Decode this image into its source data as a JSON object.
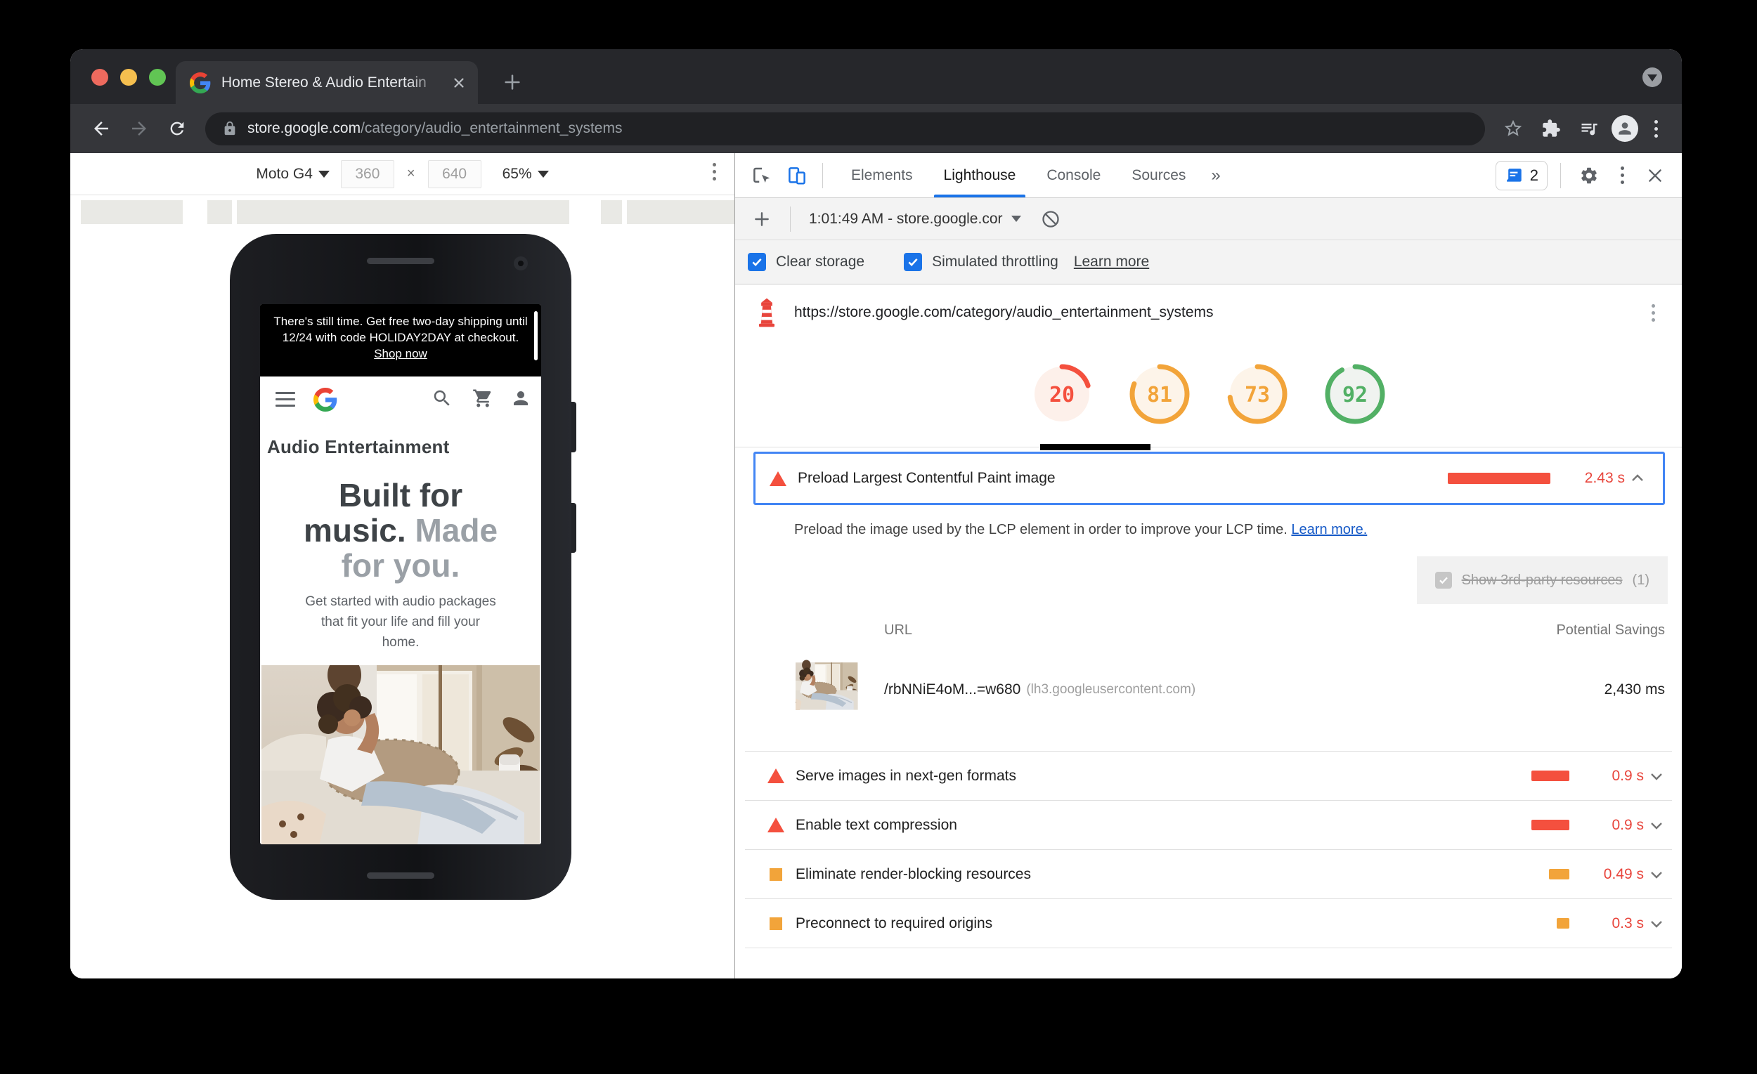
{
  "browser": {
    "tab_title": "Home Stereo & Audio Entertain",
    "url_host": "store.google.com",
    "url_path": "/category/audio_entertainment_systems"
  },
  "device_toolbar": {
    "device": "Moto G4",
    "width": "360",
    "height": "640",
    "times_separator": "×",
    "zoom": "65%"
  },
  "phone_page": {
    "banner_text": "There's still time. Get free two-day shipping until 12/24 with code HOLIDAY2DAY at checkout.",
    "banner_link": "Shop now",
    "category_title": "Audio Entertainment",
    "headline_dark_1": "Built for",
    "headline_dark_2": "music.",
    "headline_light_2": "Made",
    "headline_light_3": "for you.",
    "subtext": "Get started with audio packages that fit your life and fill your home."
  },
  "devtools": {
    "tabs": {
      "0": "Elements",
      "1": "Lighthouse",
      "2": "Console",
      "3": "Sources"
    },
    "more_tabs_label": "»",
    "issues_count": "2"
  },
  "lighthouse": {
    "report_time": "1:01:49 AM - store.google.cor",
    "clear_storage_label": "Clear storage",
    "throttling_label": "Simulated throttling",
    "learn_more_label": "Learn more",
    "url": "https://store.google.com/category/audio_entertainment_systems",
    "scores": [
      {
        "value": 20,
        "status": "fail"
      },
      {
        "value": 81,
        "status": "average"
      },
      {
        "value": 73,
        "status": "average"
      },
      {
        "value": 92,
        "status": "pass"
      }
    ],
    "colors": {
      "fail": "#f4503e",
      "fail_bg": "#fdf0ea",
      "average": "#f2a43a",
      "average_bg": "#fdf4e9",
      "pass": "#52b065",
      "pass_bg": "#f0f3f0",
      "accent_blue": "#1a73e8",
      "focus_border": "#4285f4",
      "value_text": "#e8453c",
      "link_blue": "#1559c7"
    },
    "expanded_audit": {
      "title": "Preload Largest Contentful Paint image",
      "savings": "2.43 s",
      "seconds": 2.43,
      "severity": "fail",
      "description": "Preload the image used by the LCP element in order to improve your LCP time.",
      "learn_more": "Learn more.",
      "third_party_label": "Show 3rd-party resources",
      "third_party_count": "(1)",
      "table": {
        "col_url": "URL",
        "col_savings": "Potential Savings",
        "row": {
          "url": "/rbNNiE4oM...=w680",
          "origin": "(lh3.googleusercontent.com)",
          "savings": "2,430 ms"
        }
      }
    },
    "audits": [
      {
        "title": "Serve images in next-gen formats",
        "savings": "0.9 s",
        "seconds": 0.9,
        "severity": "fail"
      },
      {
        "title": "Enable text compression",
        "savings": "0.9 s",
        "seconds": 0.9,
        "severity": "fail"
      },
      {
        "title": "Eliminate render-blocking resources",
        "savings": "0.49 s",
        "seconds": 0.49,
        "severity": "average"
      },
      {
        "title": "Preconnect to required origins",
        "savings": "0.3 s",
        "seconds": 0.3,
        "severity": "average"
      }
    ]
  }
}
